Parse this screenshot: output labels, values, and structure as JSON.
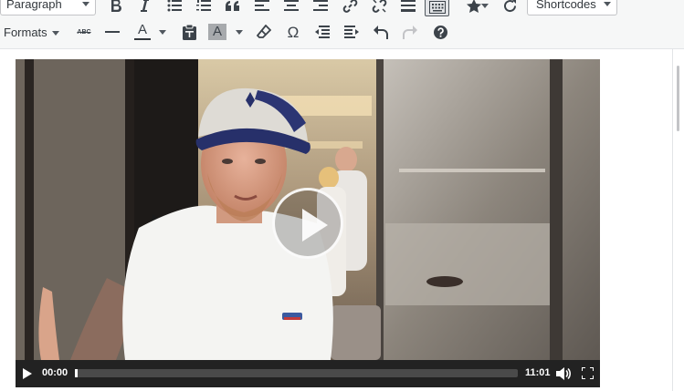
{
  "toolbar": {
    "paragraph_select": "Paragraph",
    "shortcodes_select": "Shortcodes",
    "formats_label": "Formats",
    "row1_icons": [
      "bold-icon",
      "italic-icon",
      "bulleted-list-icon",
      "numbered-list-icon",
      "blockquote-icon",
      "align-left-icon",
      "align-center-icon",
      "align-right-icon",
      "link-icon",
      "unlink-icon",
      "read-more-icon",
      "toolbar-toggle-icon",
      "star-icon",
      "refresh-icon"
    ],
    "row2_icons": [
      "strikethrough-icon",
      "horizontal-line-icon",
      "text-color-icon",
      "paste-as-text-icon",
      "background-color-icon",
      "clear-formatting-icon",
      "special-character-icon",
      "outdent-icon",
      "indent-icon",
      "undo-icon",
      "redo-icon",
      "help-icon"
    ],
    "strikethrough_glyph": "ABC",
    "text_color_glyph": "A",
    "omega_glyph": "Ω",
    "text_color": "#32373c",
    "active_toggle_bg": "#e2e4e7"
  },
  "video": {
    "current_time": "00:00",
    "duration": "11:01",
    "progress": 0.0,
    "controls_bg": "#222222",
    "icons": [
      "play-icon",
      "volume-icon",
      "fullscreen-icon",
      "play-overlay-icon"
    ]
  }
}
